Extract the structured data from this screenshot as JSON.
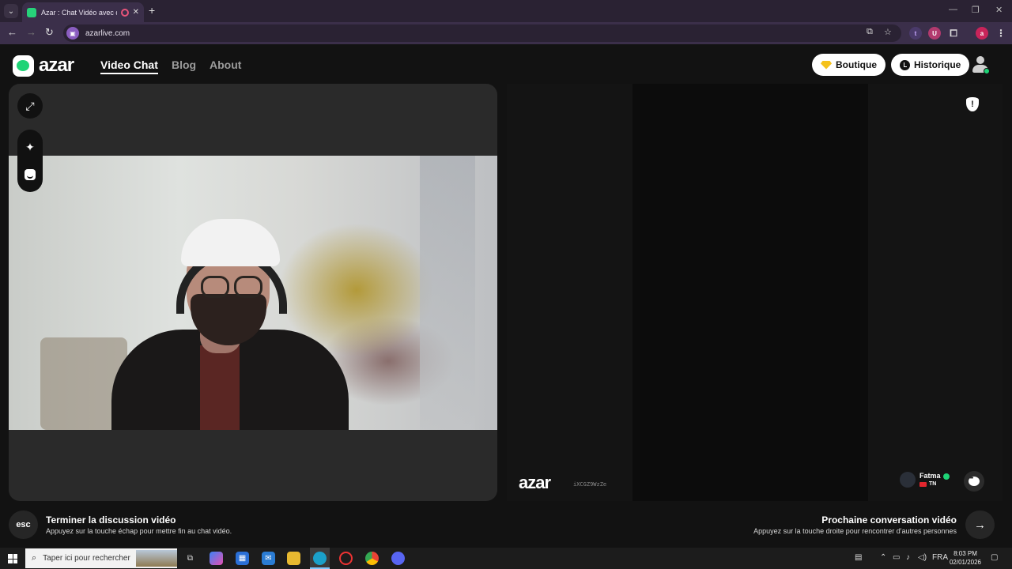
{
  "browser": {
    "tab_title": "Azar : Chat Vidéo avec de nouveaux amis",
    "url": "azarlive.com",
    "new_tab_glyph": "+",
    "close_glyph": "✕",
    "ext_t": "t",
    "ext_u": "U",
    "ext_a": "a"
  },
  "header": {
    "logo_text": "azar",
    "nav": [
      {
        "label": "Video Chat"
      },
      {
        "label": "Blog"
      },
      {
        "label": "About"
      }
    ],
    "boutique_label": "Boutique",
    "historique_label": "Historique"
  },
  "partner": {
    "watermark": "azar",
    "code": "iXCGZ9WzZe",
    "name": "Fatma",
    "country": "TN"
  },
  "hints": {
    "esc_key": "esc",
    "end_title": "Terminer la discussion vidéo",
    "end_sub": "Appuyez sur la touche échap pour mettre fin au chat vidéo.",
    "next_title": "Prochaine conversation vidéo",
    "next_sub": "Appuyez sur la touche droite pour rencontrer d'autres personnes",
    "next_glyph": "→"
  },
  "taskbar": {
    "search_placeholder": "Taper ici pour rechercher",
    "lang": "FRA",
    "time": "8:03 PM",
    "date": "02/01/2026"
  },
  "colors": {
    "accent_green": "#1ed476",
    "browser_frame": "#3b2f4a",
    "page_bg": "#121212"
  }
}
